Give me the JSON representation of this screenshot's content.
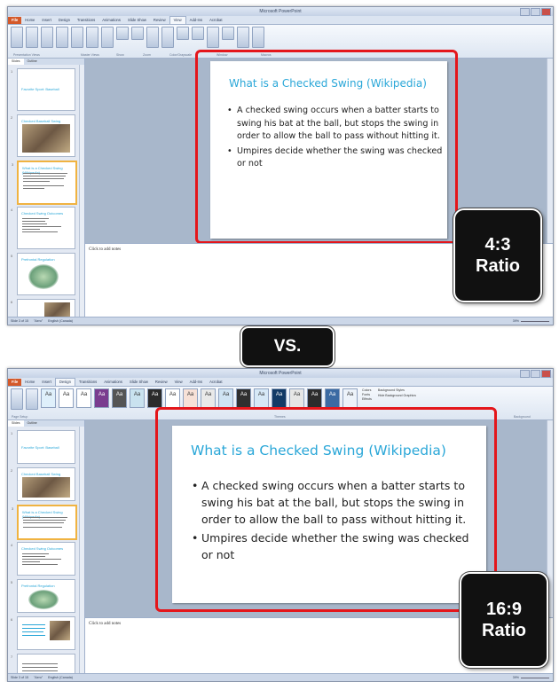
{
  "top": {
    "window_title": "Microsoft PowerPoint",
    "tabs": [
      "File",
      "Home",
      "Insert",
      "Design",
      "Transitions",
      "Animations",
      "Slide Show",
      "Review",
      "View",
      "Add-Ins",
      "Acrobat"
    ],
    "active_tab": "View",
    "ribbon_groups": [
      "Presentation Views",
      "Master Views",
      "Show",
      "Zoom",
      "Color/Grayscale",
      "Window",
      "Macros"
    ],
    "pane_tabs": [
      "Slides",
      "Outline"
    ],
    "slide": {
      "title": "What is a Checked Swing (Wikipedia)",
      "bullets": [
        "A checked swing occurs when a batter starts to swing his bat at the ball, but stops the swing in order to allow the ball to pass without hitting it.",
        "Umpires decide whether the swing was checked or not"
      ]
    },
    "notes_placeholder": "Click to add notes",
    "status": {
      "slide_info": "Slide 3 of 15",
      "theme": "\"Aero\"",
      "language": "English (Canada)",
      "zoom": "39%"
    },
    "badge": {
      "line1": "4:3",
      "line2": "Ratio"
    }
  },
  "vs_label": "VS.",
  "bottom": {
    "window_title": "Microsoft PowerPoint",
    "tabs": [
      "File",
      "Home",
      "Insert",
      "Design",
      "Transitions",
      "Animations",
      "Slide Show",
      "Review",
      "View",
      "Add-Ins",
      "Acrobat"
    ],
    "active_tab": "Design",
    "ribbon_groups": [
      "Page Setup",
      "Themes",
      "Background"
    ],
    "ribbon_right": [
      "Colors",
      "Fonts",
      "Effects",
      "Background Styles",
      "Hide Background Graphics"
    ],
    "pane_tabs": [
      "Slides",
      "Outline"
    ],
    "slide": {
      "title": "What is a Checked Swing (Wikipedia)",
      "bullets": [
        "A checked swing occurs when a batter starts to swing his bat at the ball, but stops the swing in order to allow the ball to pass without hitting it.",
        "Umpires decide whether the swing was checked or not"
      ]
    },
    "notes_placeholder": "Click to add notes",
    "status": {
      "slide_info": "Slide 3 of 15",
      "theme": "\"Aero\"",
      "language": "English (Canada)",
      "zoom": "39%"
    },
    "badge": {
      "line1": "16:9",
      "line2": "Ratio"
    }
  },
  "thumbnails": {
    "slide1_title": "Favorite Sport: Baseball",
    "slide2_title": "Checked Baseball Swing",
    "slide3_title": "What is a Checked Swing (Wikipedia)",
    "slide4_title": "Checked Swing Outcomes",
    "slide5_title": "Prefrontal Regulation"
  }
}
